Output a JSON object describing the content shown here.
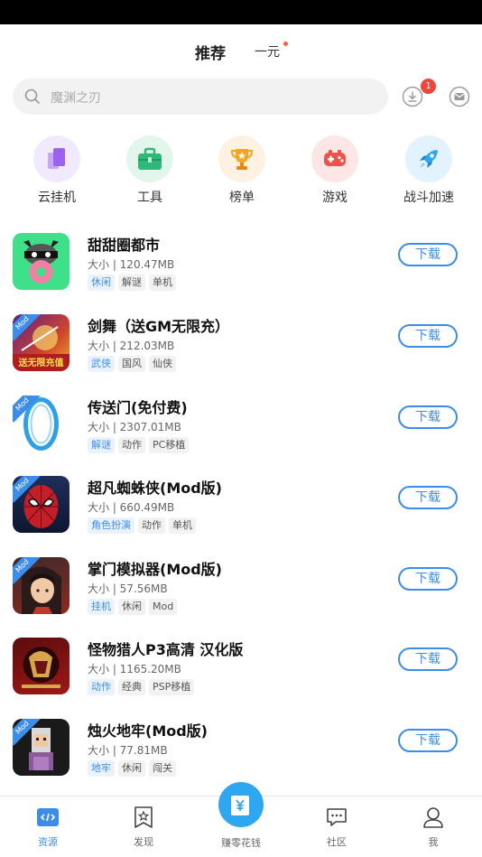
{
  "top_tabs": {
    "recommend": "推荐",
    "yuan": "一元"
  },
  "search": {
    "placeholder": "魔渊之刃"
  },
  "header": {
    "download_badge": "1"
  },
  "categories": [
    {
      "label": "云挂机",
      "icon": "cloud-phone-icon",
      "color": "#b07af0"
    },
    {
      "label": "工具",
      "icon": "toolbox-icon",
      "color": "#2fb877"
    },
    {
      "label": "榜单",
      "icon": "trophy-icon",
      "color": "#f4a325"
    },
    {
      "label": "游戏",
      "icon": "gamepad-icon",
      "color": "#f0514a"
    },
    {
      "label": "战斗加速",
      "icon": "rocket-icon",
      "color": "#2fa6f0"
    }
  ],
  "apps": [
    {
      "name": "甜甜圈都市",
      "size": "大小 | 120.47MB",
      "tags": [
        "休闲",
        "解谜",
        "单机"
      ],
      "mod": "",
      "button": "下载"
    },
    {
      "name": "剑舞（送GM无限充）",
      "size": "大小 | 212.03MB",
      "tags": [
        "武侠",
        "国风",
        "仙侠"
      ],
      "mod": "Mod",
      "button": "下载",
      "icon_text": "送无限充值"
    },
    {
      "name": "传送门(免付费)",
      "size": "大小 | 2307.01MB",
      "tags": [
        "解谜",
        "动作",
        "PC移植"
      ],
      "mod": "Mod",
      "button": "下载"
    },
    {
      "name": "超凡蜘蛛侠(Mod版)",
      "size": "大小 | 660.49MB",
      "tags": [
        "角色扮演",
        "动作",
        "单机"
      ],
      "mod": "Mod",
      "button": "下载"
    },
    {
      "name": "掌门模拟器(Mod版)",
      "size": "大小 | 57.56MB",
      "tags": [
        "挂机",
        "休闲",
        "Mod"
      ],
      "mod": "Mod",
      "button": "下载"
    },
    {
      "name": "怪物猎人P3高清  汉化版",
      "size": "大小 | 1165.20MB",
      "tags": [
        "动作",
        "经典",
        "PSP移植"
      ],
      "mod": "",
      "button": "下载"
    },
    {
      "name": "烛火地牢(Mod版)",
      "size": "大小 | 77.81MB",
      "tags": [
        "地牢",
        "休闲",
        "闯关"
      ],
      "mod": "Mod",
      "button": "下载"
    }
  ],
  "bottom_nav": {
    "resources": "资源",
    "discover": "发现",
    "earn": "赚零花钱",
    "community": "社区",
    "me": "我"
  },
  "colors": {
    "accent": "#3c8dea",
    "badge": "#f0463c"
  }
}
